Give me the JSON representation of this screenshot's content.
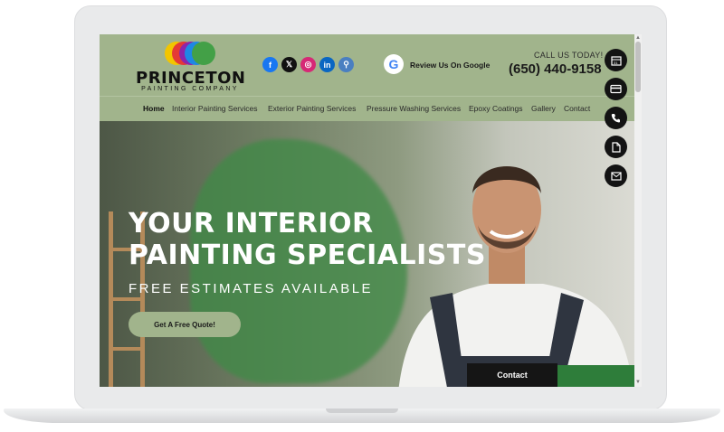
{
  "brand": {
    "name": "PRINCETON",
    "tagline": "PAINTING COMPANY",
    "circle_colors": [
      "#f2c500",
      "#e53935",
      "#8e24aa",
      "#1e88e5",
      "#43a047"
    ]
  },
  "socials": [
    {
      "icon": "facebook-icon",
      "glyph": "f",
      "color": "#1877f2"
    },
    {
      "icon": "x-icon",
      "glyph": "𝕏",
      "color": "#111111"
    },
    {
      "icon": "instagram-icon",
      "glyph": "◎",
      "color": "#d62976"
    },
    {
      "icon": "linkedin-icon",
      "glyph": "in",
      "color": "#0a66c2"
    },
    {
      "icon": "nextdoor-icon",
      "glyph": "⚲",
      "color": "#4a7fc1"
    }
  ],
  "review": {
    "google_glyph": "G",
    "label": "Review Us On Google"
  },
  "call": {
    "label": "CALL US TODAY!",
    "phone": "(650) 440-9158"
  },
  "nav": [
    "Home",
    "Interior Painting Services",
    "Exterior Painting Services",
    "Pressure Washing Services",
    "Epoxy Coatings",
    "Gallery",
    "Contact"
  ],
  "hero": {
    "title_line1": "YOUR INTERIOR",
    "title_line2": "PAINTING SPECIALISTS",
    "subtitle": "FREE ESTIMATES AVAILABLE",
    "cta": "Get A Free Quote!"
  },
  "contact_tab": "Contact",
  "floating_actions": [
    "calendar-icon",
    "credit-card-icon",
    "phone-icon",
    "document-icon",
    "mail-icon"
  ],
  "colors": {
    "accent": "#a1b48c",
    "dark": "#131313"
  }
}
